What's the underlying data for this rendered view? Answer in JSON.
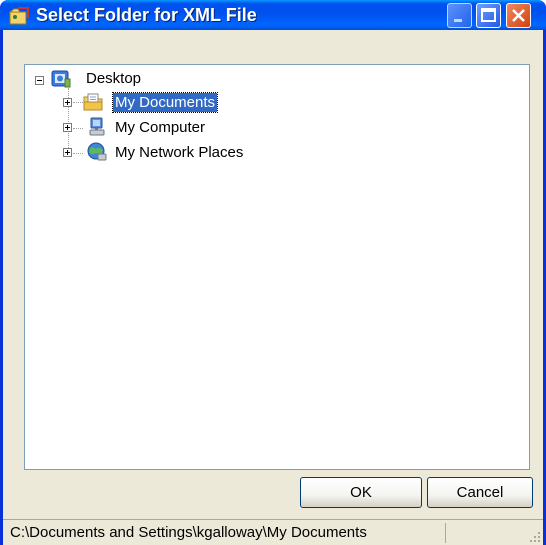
{
  "window": {
    "title": "Select Folder for XML File",
    "icon": "xml-folder-icon"
  },
  "titlebar_buttons": {
    "minimize": "minimize-icon",
    "maximize": "maximize-icon",
    "close": "close-icon"
  },
  "tree": {
    "root": {
      "label": "Desktop",
      "icon": "desktop-icon",
      "expanded": true
    },
    "items": [
      {
        "label": "My Documents",
        "icon": "my-documents-icon",
        "selected": true,
        "expanded": false
      },
      {
        "label": "My Computer",
        "icon": "my-computer-icon",
        "selected": false,
        "expanded": false
      },
      {
        "label": "My Network Places",
        "icon": "network-places-icon",
        "selected": false,
        "expanded": false
      }
    ]
  },
  "buttons": {
    "ok": "OK",
    "cancel": "Cancel"
  },
  "status": {
    "path": "C:\\Documents and Settings\\kgalloway\\My Documents"
  },
  "colors": {
    "titlebar": "#0054e3",
    "selection": "#316ac5",
    "dialog_bg": "#ece9d8"
  }
}
